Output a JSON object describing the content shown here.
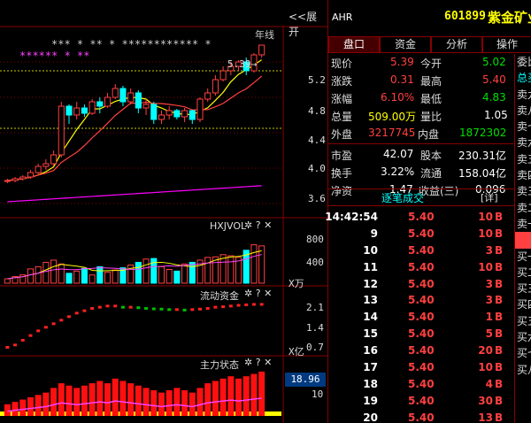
{
  "chart": {
    "expand_label": "<<展开",
    "period_label": "年线",
    "high_marker": "5.39→",
    "price_ticks": [
      "5.2",
      "4.8",
      "4.4",
      "4.0",
      "3.6"
    ],
    "volume": {
      "title": "HXJVOL",
      "ticks": [
        "800",
        "400"
      ],
      "unit": "X万"
    },
    "capital": {
      "title": "流动资金",
      "ticks": [
        "2.1",
        "1.4",
        "0.7"
      ],
      "unit": "X亿"
    },
    "mainforce": {
      "title": "主力状态",
      "ticks": [
        "10"
      ],
      "value_box": "18.96"
    },
    "icons": [
      "gear-icon",
      "help-icon",
      "close-icon"
    ],
    "star_row1": "*** *  **   *  ************  *",
    "star_row2": "******  *  **"
  },
  "chart_data": {
    "type": "candlestick",
    "candles": [
      [
        3.85,
        3.88,
        3.83,
        3.86
      ],
      [
        3.86,
        3.9,
        3.84,
        3.88
      ],
      [
        3.88,
        3.92,
        3.86,
        3.9
      ],
      [
        3.9,
        3.98,
        3.88,
        3.95
      ],
      [
        3.95,
        4.05,
        3.93,
        4.02
      ],
      [
        4.02,
        4.1,
        3.98,
        4.05
      ],
      [
        4.05,
        4.2,
        4.02,
        4.15
      ],
      [
        4.15,
        4.75,
        4.12,
        4.7
      ],
      [
        4.7,
        4.72,
        4.5,
        4.6
      ],
      [
        4.6,
        4.75,
        4.55,
        4.68
      ],
      [
        4.68,
        4.72,
        4.58,
        4.62
      ],
      [
        4.62,
        4.78,
        4.6,
        4.75
      ],
      [
        4.75,
        4.8,
        4.62,
        4.7
      ],
      [
        4.7,
        4.85,
        4.68,
        4.8
      ],
      [
        4.8,
        4.95,
        4.78,
        4.9
      ],
      [
        4.9,
        4.93,
        4.7,
        4.75
      ],
      [
        4.75,
        4.9,
        4.72,
        4.85
      ],
      [
        4.85,
        4.88,
        4.62,
        4.68
      ],
      [
        4.68,
        4.78,
        4.6,
        4.72
      ],
      [
        4.72,
        4.75,
        4.5,
        4.55
      ],
      [
        4.55,
        4.65,
        4.5,
        4.6
      ],
      [
        4.6,
        4.7,
        4.55,
        4.65
      ],
      [
        4.65,
        4.67,
        4.55,
        4.58
      ],
      [
        4.58,
        4.68,
        4.52,
        4.65
      ],
      [
        4.65,
        4.66,
        4.5,
        4.55
      ],
      [
        4.55,
        4.8,
        4.52,
        4.78
      ],
      [
        4.78,
        4.9,
        4.75,
        4.85
      ],
      [
        4.85,
        5.05,
        4.82,
        5.0
      ],
      [
        5.0,
        5.15,
        4.98,
        5.1
      ],
      [
        5.1,
        5.2,
        5.05,
        5.15
      ],
      [
        5.15,
        5.22,
        5.1,
        5.2
      ],
      [
        5.2,
        5.25,
        5.05,
        5.1
      ],
      [
        5.1,
        5.3,
        5.08,
        5.28
      ],
      [
        5.28,
        5.39,
        5.25,
        5.39
      ]
    ],
    "price_range": [
      3.5,
      5.5
    ],
    "volume_values": [
      80,
      120,
      150,
      260,
      300,
      380,
      420,
      350,
      180,
      220,
      270,
      150,
      300,
      200,
      240,
      280,
      330,
      380,
      440,
      450,
      300,
      250,
      220,
      350,
      380,
      420,
      470,
      480,
      520,
      500,
      470,
      600,
      700,
      680
    ],
    "volume_range": [
      0,
      1000
    ],
    "capital_values": [
      0.3,
      0.4,
      0.6,
      0.8,
      1.0,
      1.15,
      1.3,
      1.45,
      1.6,
      1.75,
      1.85,
      1.95,
      2.0,
      2.05,
      2.05,
      2.0,
      2.0,
      1.98,
      1.95,
      1.93,
      1.92,
      1.9,
      1.9,
      1.88,
      1.9,
      1.92,
      1.95,
      2.0,
      2.02,
      2.05,
      2.08,
      2.1,
      2.12,
      2.12
    ],
    "capital_range": [
      0,
      2.4
    ],
    "mainforce_values": [
      5,
      6,
      7,
      8,
      9,
      10,
      12,
      14,
      13,
      12,
      13,
      14,
      15,
      14,
      16,
      15,
      14,
      13,
      12,
      11,
      10,
      11,
      12,
      11,
      10,
      12,
      14,
      15,
      16,
      17,
      16,
      17,
      18,
      19
    ],
    "mainforce_range": [
      0,
      22
    ]
  },
  "header": {
    "exchange": "AHR",
    "code": "601899",
    "name": "紫金矿业"
  },
  "tabs": [
    {
      "label": "盘口",
      "active": true
    },
    {
      "label": "资金",
      "active": false
    },
    {
      "label": "分析",
      "active": false
    },
    {
      "label": "操作",
      "active": false
    }
  ],
  "quote": {
    "now_label": "现价",
    "now": "5.39",
    "open_label": "今开",
    "open": "5.02",
    "chg_label": "涨跌",
    "chg": "0.31",
    "high_label": "最高",
    "high": "5.40",
    "pct_label": "涨幅",
    "pct": "6.10%",
    "low_label": "最低",
    "low": "4.83",
    "vol_label": "总量",
    "vol": "509.00万",
    "ratio_label": "量比",
    "ratio": "1.05",
    "out_label": "外盘",
    "out": "3217745",
    "in_label": "内盘",
    "in": "1872302",
    "pe_label": "市盈",
    "pe": "42.07",
    "cap_label": "股本",
    "cap": "230.31亿",
    "turn_label": "换手",
    "turn": "3.22%",
    "float_label": "流通",
    "float": "158.04亿",
    "nav_label": "净资",
    "nav": "1.47",
    "eps_label": "收益(三)",
    "eps": "0.096"
  },
  "side_items": [
    "委比",
    "总买",
    "卖九",
    "卖八",
    "卖七",
    "卖六",
    "卖五",
    "卖四",
    "卖三",
    "卖二",
    "卖一",
    "",
    "买一",
    "买二",
    "买三",
    "买四",
    "买五",
    "买六",
    "买七",
    "买八"
  ],
  "trades_title": "逐笔成交",
  "trades_detail": "[详]",
  "trades": [
    {
      "time": "14:42:54",
      "price": "5.40",
      "vol": "10",
      "side": "B"
    },
    {
      "time": "9",
      "price": "5.40",
      "vol": "10",
      "side": "B"
    },
    {
      "time": "10",
      "price": "5.40",
      "vol": "3",
      "side": "B"
    },
    {
      "time": "11",
      "price": "5.40",
      "vol": "10",
      "side": "B"
    },
    {
      "time": "12",
      "price": "5.40",
      "vol": "3",
      "side": "B"
    },
    {
      "time": "13",
      "price": "5.40",
      "vol": "3",
      "side": "B"
    },
    {
      "time": "14",
      "price": "5.40",
      "vol": "1",
      "side": "B"
    },
    {
      "time": "15",
      "price": "5.40",
      "vol": "5",
      "side": "B"
    },
    {
      "time": "16",
      "price": "5.40",
      "vol": "20",
      "side": "B"
    },
    {
      "time": "17",
      "price": "5.40",
      "vol": "10",
      "side": "B"
    },
    {
      "time": "18",
      "price": "5.40",
      "vol": "4",
      "side": "B"
    },
    {
      "time": "19",
      "price": "5.40",
      "vol": "30",
      "side": "B"
    },
    {
      "time": "20",
      "price": "5.40",
      "vol": "13",
      "side": "B"
    }
  ]
}
